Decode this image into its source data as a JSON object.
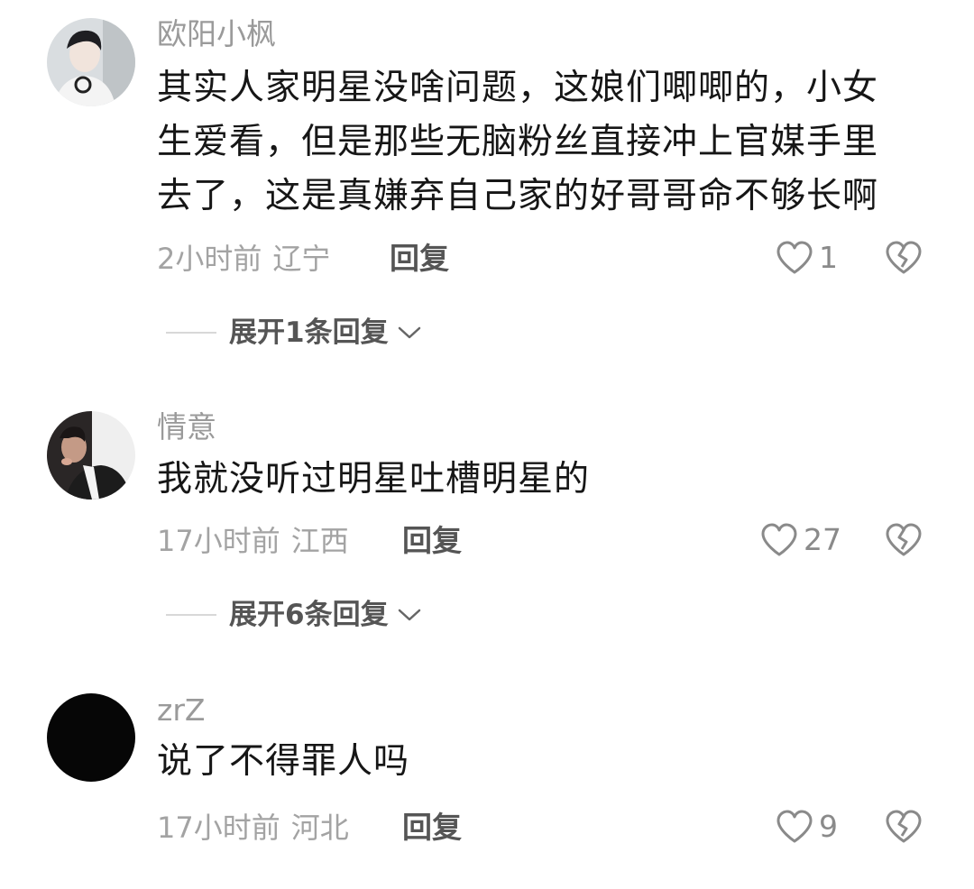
{
  "comments": [
    {
      "username": "欧阳小枫",
      "lines": [
        "其实人家明星没啥问题，这娘们唧唧的，小女",
        "生爱看，但是那些无脑粉丝直接冲上官媒手里",
        "去了，这是真嫌弃自己家的好哥哥命不够长啊"
      ],
      "time": "2小时前",
      "location": "辽宁",
      "reply_label": "回复",
      "likes": "1",
      "expand_label": "展开1条回复"
    },
    {
      "username": "情意",
      "lines": [
        "我就没听过明星吐槽明星的"
      ],
      "time": "17小时前",
      "location": "江西",
      "reply_label": "回复",
      "likes": "27",
      "expand_label": "展开6条回复"
    },
    {
      "username": "zrZ",
      "lines": [
        "说了不得罪人吗"
      ],
      "time": "17小时前",
      "location": "河北",
      "reply_label": "回复",
      "likes": "9"
    }
  ],
  "icons": {
    "like": "heart-outline-icon",
    "dislike": "broken-heart-icon",
    "expand": "chevron-down-icon"
  },
  "colors": {
    "text": "#161616",
    "muted": "#9a9a9a",
    "reply": "#555555"
  }
}
